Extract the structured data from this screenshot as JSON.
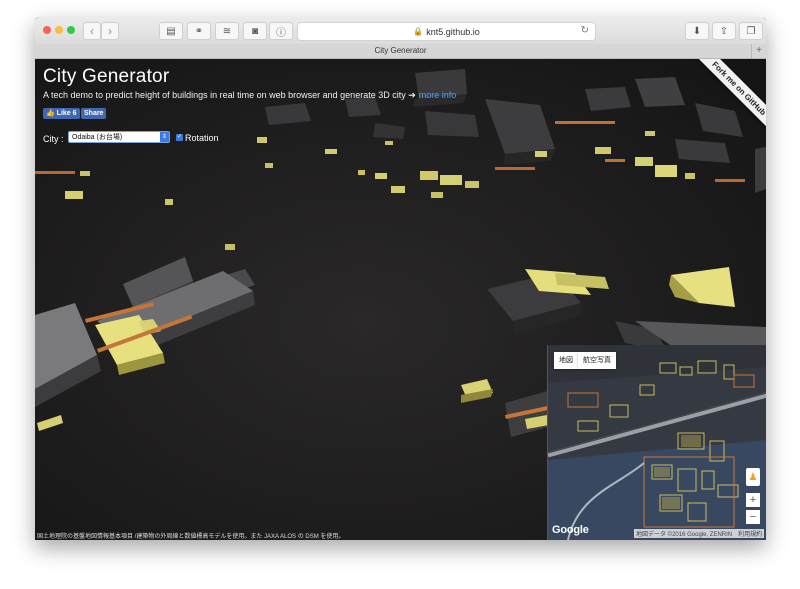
{
  "browser": {
    "tab_title": "City Generator",
    "url": "knt5.github.io",
    "new_tab": "+"
  },
  "page": {
    "title": "City Generator",
    "subtitle": "A tech demo to predict height of buildings in real time on web browser and generate 3D city ➔",
    "more_info": "more info",
    "like_label": "Like 6",
    "share_label": "Share",
    "city_label": "City :",
    "city_value": "Odaiba (お台場)",
    "rotation_label": "Rotation",
    "rotation_checked": true,
    "ribbon": "Fork me on GitHub",
    "footer_note": "国土地理院の基盤地図情報基本項目 /建築物の外周線と数値標高モデルを使用。また JAXA ALOS の DSM を使用。"
  },
  "minimap": {
    "tabs": [
      "地図",
      "航空写真"
    ],
    "zoom_in": "+",
    "zoom_out": "−",
    "logo": "Google",
    "attribution": "地図データ ©2016 Google, ZENRIN　利用規約"
  },
  "icons": {
    "back": "chevron-left-icon",
    "forward": "chevron-right-icon",
    "lock": "lock-icon",
    "reload": "reload-icon",
    "download": "download-icon",
    "share": "share-icon",
    "tabs": "tabs-icon"
  },
  "colors": {
    "building_dark": "#3a3a3c",
    "building_lit": "#d8d370",
    "edge_orange": "#c87838",
    "link": "#4aa3ff",
    "facebook": "#4267b2"
  }
}
